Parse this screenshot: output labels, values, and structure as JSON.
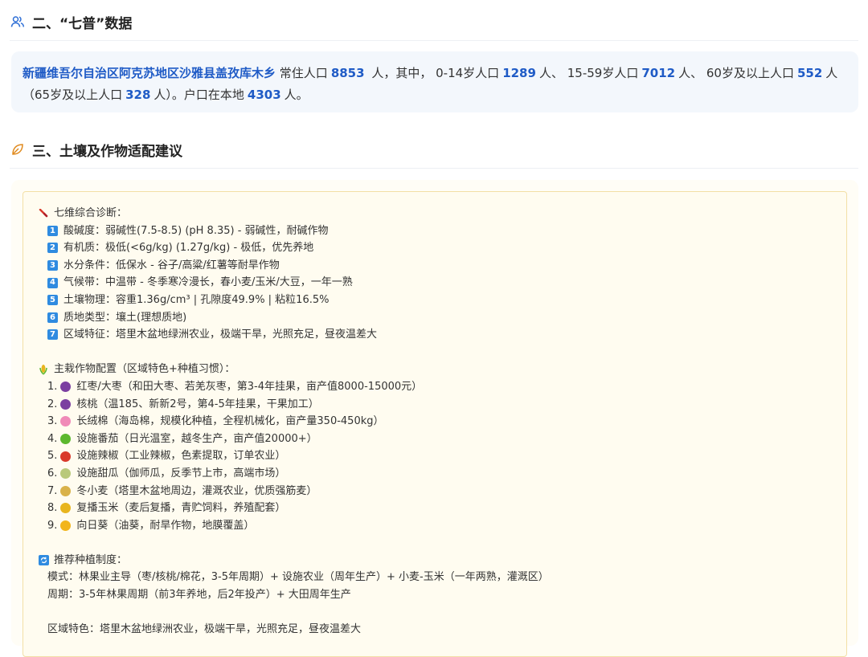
{
  "census_section": {
    "title": "二、“七普”数据",
    "icon": "users-icon",
    "place": "新疆维吾尔自治区阿克苏地区沙雅县盖孜库木乡",
    "t_resident": "常住人口",
    "resident": "8853",
    "t_unit_mid": "人，其中，",
    "t_age0_14": "0-14岁人口",
    "age0_14": "1289",
    "t_unit_sep1": "人、",
    "t_age15_59": "15-59岁人口",
    "age15_59": "7012",
    "t_unit_sep2": "人、",
    "t_age60": "60岁及以上人口",
    "age60": "552",
    "t_unit_end1": "人",
    "t_age65": "（65岁及以上人口",
    "age65": "328",
    "t_unit_end2": "人）。户口在本地",
    "local": "4303",
    "t_unit_end3": "人。"
  },
  "soil_section": {
    "title": "三、土壤及作物适配建议",
    "icon": "leaf-icon",
    "diagnosis": {
      "icon": "test-tube-icon",
      "heading": "七维综合诊断：",
      "items": [
        {
          "n": "1",
          "text": "酸碱度：弱碱性(7.5-8.5) (pH 8.35) - 弱碱性，耐碱作物"
        },
        {
          "n": "2",
          "text": "有机质：极低(<6g/kg) (1.27g/kg) - 极低，优先养地"
        },
        {
          "n": "3",
          "text": "水分条件：低保水 - 谷子/高粱/红薯等耐旱作物"
        },
        {
          "n": "4",
          "text": "气候带：中温带 - 冬季寒冷漫长，春小麦/玉米/大豆，一年一熟"
        },
        {
          "n": "5",
          "text": "土壤物理：容重1.36g/cm³ | 孔隙度49.9% | 粘粒16.5%"
        },
        {
          "n": "6",
          "text": "质地类型：壤土(理想质地)"
        },
        {
          "n": "7",
          "text": "区域特征：塔里木盆地绿洲农业，极端干旱，光照充足，昼夜温差大"
        }
      ]
    },
    "crops": {
      "icon": "corn-icon",
      "heading": "主栽作物配置（区域特色+种植习惯）：",
      "items": [
        {
          "n": "1.",
          "icon": "grape-icon",
          "color": "#7b3fa0",
          "text": "红枣/大枣（和田大枣、若羌灰枣，第3-4年挂果，亩产值8000-15000元）"
        },
        {
          "n": "2.",
          "icon": "grape-icon",
          "color": "#7b3fa0",
          "text": "核桃（温185、新新2号，第4-5年挂果，干果加工）"
        },
        {
          "n": "3.",
          "icon": "blossom-icon",
          "color": "#f08ab8",
          "text": "长绒棉（海岛棉，规模化种植，全程机械化，亩产量350-450kg）"
        },
        {
          "n": "4.",
          "icon": "tomato-icon",
          "color": "#5cb82e",
          "text": "设施番茄（日光温室，越冬生产，亩产值20000+）"
        },
        {
          "n": "5.",
          "icon": "chili-icon",
          "color": "#d93a2b",
          "text": "设施辣椒（工业辣椒，色素提取，订单农业）"
        },
        {
          "n": "6.",
          "icon": "melon-icon",
          "color": "#b9c97a",
          "text": "设施甜瓜（伽师瓜，反季节上市，高端市场）"
        },
        {
          "n": "7.",
          "icon": "wheat-icon",
          "color": "#d9b24a",
          "text": "冬小麦（塔里木盆地周边，灌溉农业，优质强筋麦）"
        },
        {
          "n": "8.",
          "icon": "corn-icon",
          "color": "#e8b51e",
          "text": "复播玉米（麦后复播，青贮饲料，养殖配套）"
        },
        {
          "n": "9.",
          "icon": "sunflower-icon",
          "color": "#f2b51b",
          "text": "向日葵（油葵，耐旱作物，地膜覆盖）"
        }
      ]
    },
    "system": {
      "icon": "cycle-icon",
      "heading": "推荐种植制度：",
      "mode": "模式：林果业主导（枣/核桃/棉花，3-5年周期）+ 设施农业（周年生产）+ 小麦-玉米（一年两熟，灌溉区）",
      "period": "周期：3-5年林果周期（前3年养地，后2年投产）+ 大田周年生产",
      "region": "区域特色：塔里木盆地绿洲农业，极端干旱，光照充足，昼夜温差大"
    }
  }
}
